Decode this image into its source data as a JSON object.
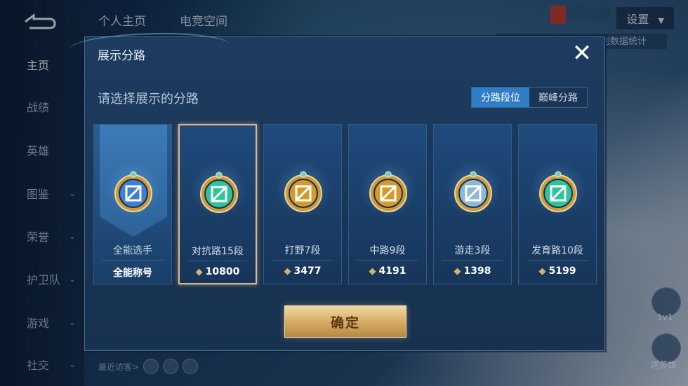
{
  "nav": {
    "items": [
      {
        "label": "主页",
        "active": true,
        "chevron": false
      },
      {
        "label": "战绩",
        "active": false,
        "chevron": false
      },
      {
        "label": "英雄",
        "active": false,
        "chevron": false
      },
      {
        "label": "图鉴",
        "active": false,
        "chevron": true
      },
      {
        "label": "荣誉",
        "active": false,
        "chevron": true
      },
      {
        "label": "护卫队",
        "active": false,
        "chevron": true
      },
      {
        "label": "游戏",
        "active": false,
        "chevron": true
      },
      {
        "label": "社交",
        "active": false,
        "chevron": true
      }
    ]
  },
  "tabs": [
    "个人主页",
    "电竞空间"
  ],
  "settings_label": "设置",
  "hero_data_label": "利数据统计",
  "recent_label": "最近访客>",
  "side_label_1": "1v1",
  "side_label_2": "送英雄",
  "modal": {
    "title": "展示分路",
    "subtitle": "请选择展示的分路",
    "close_icon": "close-icon",
    "segments": [
      {
        "label": "分路段位",
        "selected": true
      },
      {
        "label": "巅峰分路",
        "selected": false
      }
    ],
    "cards": [
      {
        "name": "全能选手",
        "value": "全能称号",
        "icon": "all-round-medal-icon",
        "selected": false,
        "show_points_icon": false,
        "medal": "#3f7fd0"
      },
      {
        "name": "对抗路15段",
        "value": "10800",
        "icon": "clash-lane-medal-icon",
        "selected": true,
        "show_points_icon": true,
        "medal": "#2ec39a"
      },
      {
        "name": "打野7段",
        "value": "3477",
        "icon": "jungle-medal-icon",
        "selected": false,
        "show_points_icon": true,
        "medal": "#d59a2a"
      },
      {
        "name": "中路9段",
        "value": "4191",
        "icon": "mid-lane-medal-icon",
        "selected": false,
        "show_points_icon": true,
        "medal": "#d59a2a"
      },
      {
        "name": "游走3段",
        "value": "1398",
        "icon": "roam-medal-icon",
        "selected": false,
        "show_points_icon": true,
        "medal": "#8fb7d8"
      },
      {
        "name": "发育路10段",
        "value": "5199",
        "icon": "farm-lane-medal-icon",
        "selected": false,
        "show_points_icon": true,
        "medal": "#2ec39a"
      }
    ],
    "confirm_label": "确定"
  }
}
